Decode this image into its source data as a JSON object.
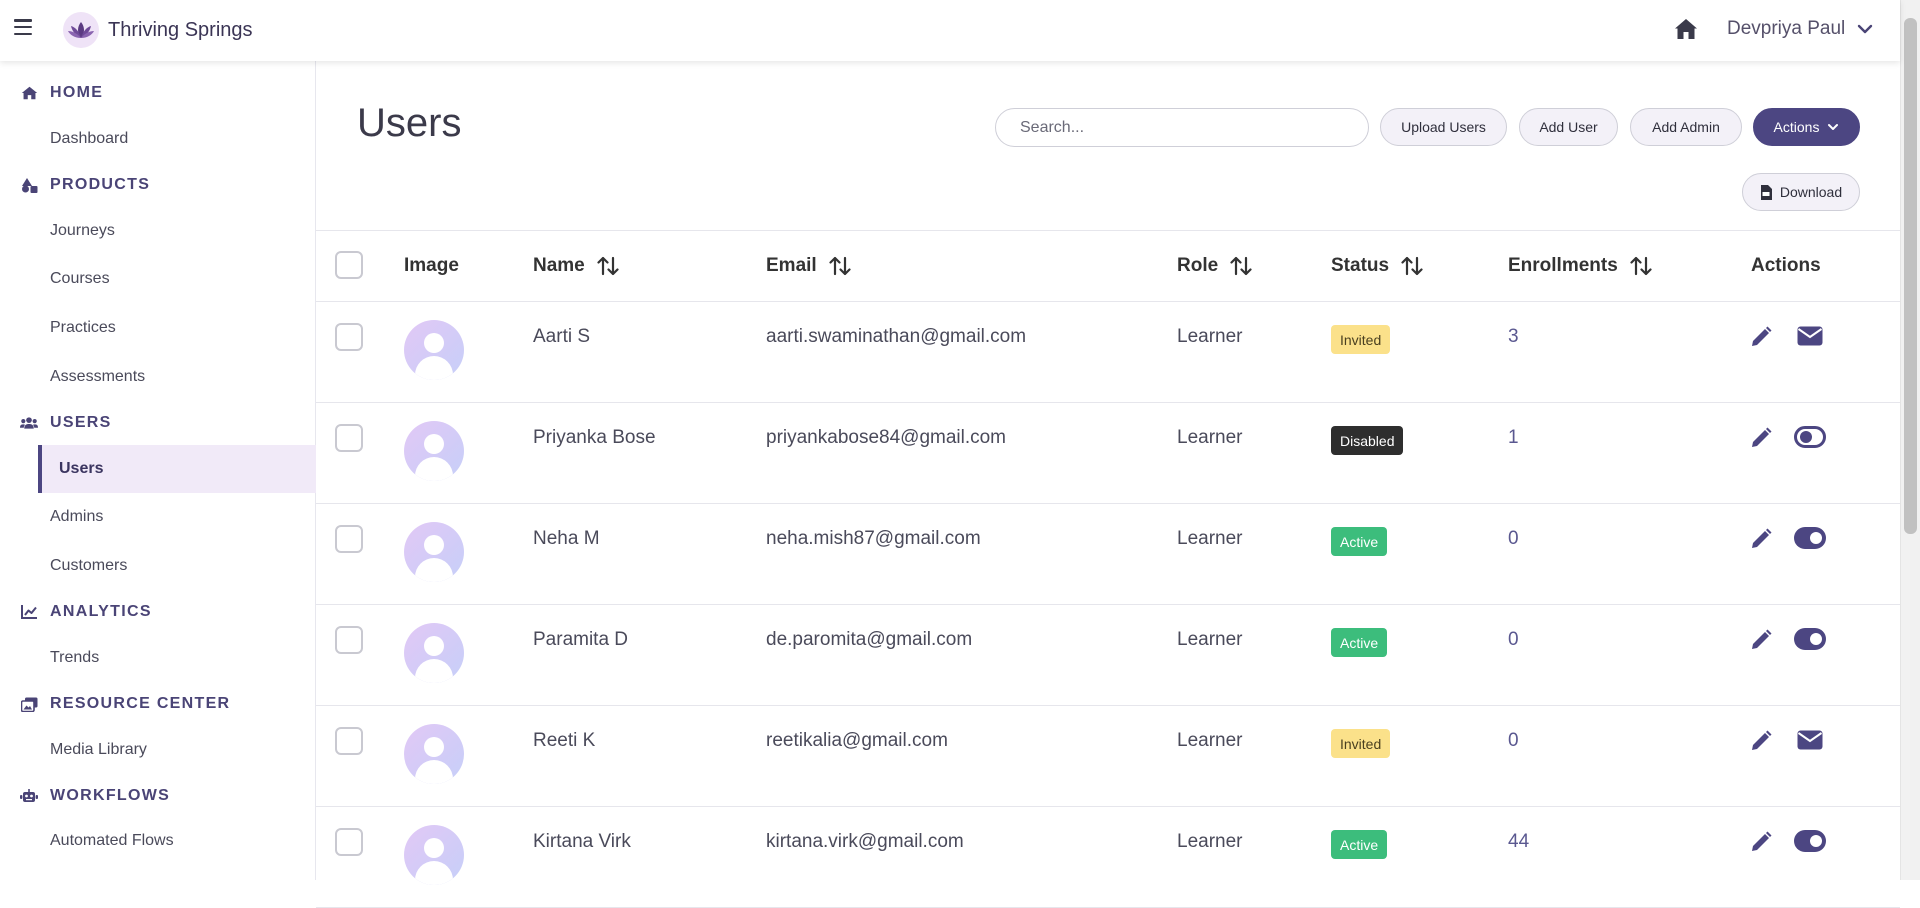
{
  "brand": {
    "name": "Thriving Springs"
  },
  "topbar": {
    "user_name": "Devpriya Paul"
  },
  "sidebar": {
    "sections": [
      {
        "label": "HOME",
        "icon": "home-icon",
        "items": [
          "Dashboard"
        ]
      },
      {
        "label": "PRODUCTS",
        "icon": "shapes-icon",
        "items": [
          "Journeys",
          "Courses",
          "Practices",
          "Assessments"
        ]
      },
      {
        "label": "USERS",
        "icon": "users-icon",
        "items": [
          "Users",
          "Admins",
          "Customers"
        ]
      },
      {
        "label": "ANALYTICS",
        "icon": "chart-line-icon",
        "items": [
          "Trends"
        ]
      },
      {
        "label": "RESOURCE CENTER",
        "icon": "photo-film-icon",
        "items": [
          "Media Library"
        ]
      },
      {
        "label": "WORKFLOWS",
        "icon": "robot-icon",
        "items": [
          "Automated Flows"
        ]
      }
    ],
    "active_item": "Users"
  },
  "main": {
    "title": "Users",
    "search_placeholder": "Search...",
    "buttons": {
      "upload_users": "Upload Users",
      "add_user": "Add User",
      "add_admin": "Add Admin",
      "actions": "Actions",
      "download": "Download"
    }
  },
  "table": {
    "columns": {
      "image": "Image",
      "name": "Name",
      "email": "Email",
      "role": "Role",
      "status": "Status",
      "enrollments": "Enrollments",
      "actions": "Actions"
    },
    "rows": [
      {
        "name": "Aarti S",
        "email": "aarti.swaminathan@gmail.com",
        "role": "Learner",
        "status": "Invited",
        "enrollments": "3",
        "secondary_action": "envelope-icon"
      },
      {
        "name": "Priyanka Bose",
        "email": "priyankabose84@gmail.com",
        "role": "Learner",
        "status": "Disabled",
        "enrollments": "1",
        "secondary_action": "toggle-off-icon"
      },
      {
        "name": "Neha M",
        "email": "neha.mish87@gmail.com",
        "role": "Learner",
        "status": "Active",
        "enrollments": "0",
        "secondary_action": "toggle-on-icon"
      },
      {
        "name": "Paramita D",
        "email": "de.paromita@gmail.com",
        "role": "Learner",
        "status": "Active",
        "enrollments": "0",
        "secondary_action": "toggle-on-icon"
      },
      {
        "name": "Reeti K",
        "email": "reetikalia@gmail.com",
        "role": "Learner",
        "status": "Invited",
        "enrollments": "0",
        "secondary_action": "envelope-icon"
      },
      {
        "name": "Kirtana Virk",
        "email": "kirtana.virk@gmail.com",
        "role": "Learner",
        "status": "Active",
        "enrollments": "44",
        "secondary_action": "toggle-on-icon"
      }
    ]
  },
  "colors": {
    "accent": "#4c4682",
    "invited_badge": "#fbe18a",
    "disabled_badge": "#2e2e2e",
    "active_badge": "#3cbd7c",
    "active_nav_bg": "#f1eaf8"
  }
}
